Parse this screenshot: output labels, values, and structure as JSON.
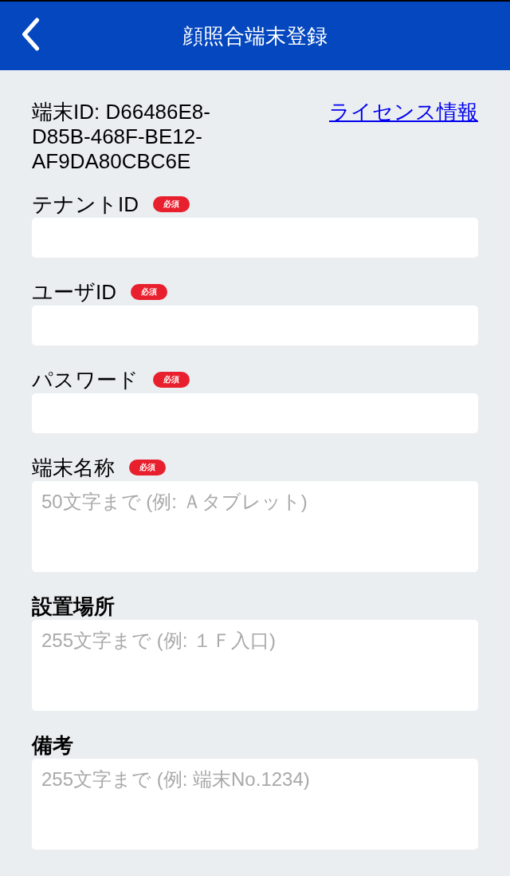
{
  "header": {
    "title": "顔照合端末登録"
  },
  "device": {
    "id_text": "端末ID: D66486E8-D85B-468F-BE12-AF9DA80CBC6E",
    "license_link": "ライセンス情報"
  },
  "fields": [
    {
      "label": "テナントID",
      "required": true,
      "badge": "必須",
      "kind": "input"
    },
    {
      "label": "ユーザID",
      "required": true,
      "badge": "必須",
      "kind": "input"
    },
    {
      "label": "パスワード",
      "required": true,
      "badge": "必須",
      "kind": "input"
    },
    {
      "label": "端末名称",
      "required": true,
      "badge": "必須",
      "kind": "textarea",
      "placeholder": "50文字まで (例: Ａタブレット)"
    },
    {
      "label": "設置場所",
      "required": false,
      "kind": "textarea",
      "placeholder": "255文字まで (例: １Ｆ入口)"
    },
    {
      "label": "備考",
      "required": false,
      "kind": "textarea",
      "placeholder": "255文字まで (例: 端末No.1234)"
    }
  ]
}
